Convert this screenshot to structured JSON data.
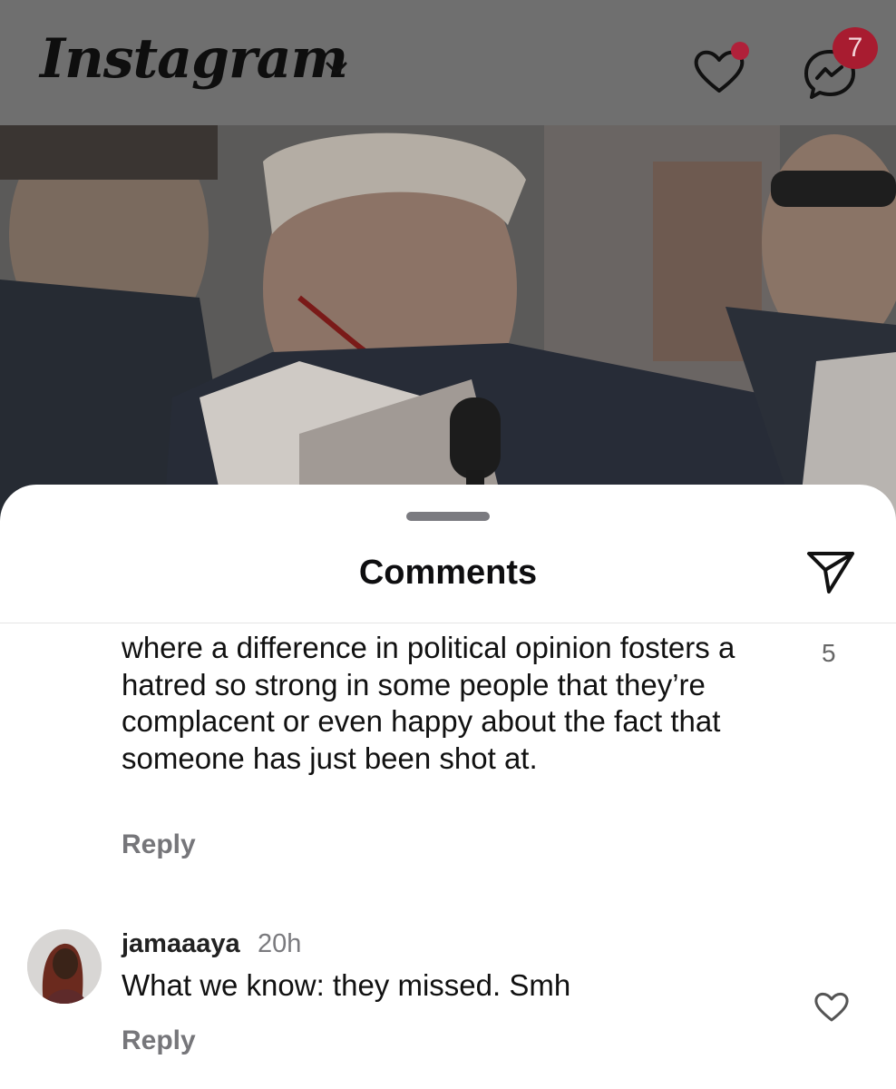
{
  "header": {
    "app_logo": "Instagram",
    "logo_dropdown_icon": "chevron-down-icon",
    "activity_icon": "heart-icon",
    "messages_icon": "messenger-icon",
    "messages_badge": "7",
    "notification_dot_color": "#b0213a"
  },
  "sheet": {
    "title": "Comments",
    "share_icon": "paper-plane-icon"
  },
  "comments": [
    {
      "username": "",
      "time": "",
      "text": "where a difference in political opinion fosters a hatred so strong in some people that they’re complacent or even happy about the fact that someone has just been shot at.",
      "likes": "5",
      "reply_label": "Reply"
    },
    {
      "username": "jamaaaya",
      "time": "20h",
      "text": "What we know: they missed. Smh",
      "likes": "",
      "reply_label": "Reply"
    }
  ],
  "colors": {
    "overlay_header": "#6f6f6f",
    "badge": "#a81c30",
    "secondary_text": "#76767a"
  }
}
